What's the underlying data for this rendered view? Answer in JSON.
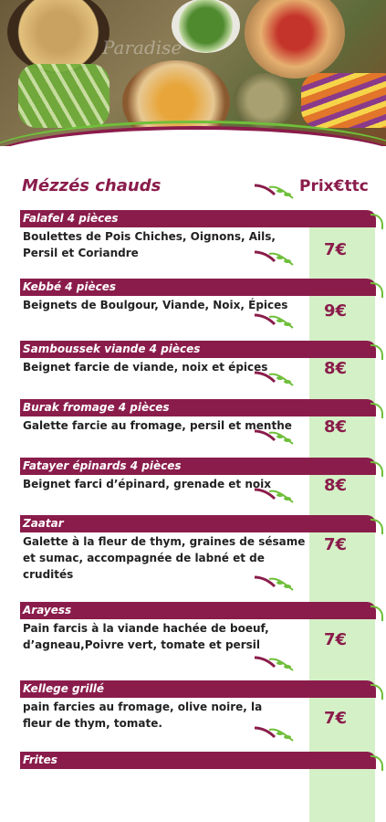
{
  "hero": {
    "brand_watermark": "Paradise"
  },
  "header": {
    "section_title": "Mézzés chauds",
    "price_title": "Prix€ttc"
  },
  "colors": {
    "accent": "#8a1c4b",
    "leaf": "#6fbf3a",
    "price_column": "#d4f0c6"
  },
  "items": [
    {
      "name": "Falafel 4 pièces",
      "description": "Boulettes de Pois Chiches, Oignons,  Ails,\n Persil et Coriandre",
      "price": "7€"
    },
    {
      "name": "Kebbé 4 pièces",
      "description": "Beignets de Boulgour, Viande, Noix, Épices",
      "price": "9€"
    },
    {
      "name": "Samboussek viande 4 pièces",
      "description": "Beignet farcie de viande, noix et épices",
      "price": "8€"
    },
    {
      "name": "Burak fromage 4 pièces",
      "description": "Galette farcie au fromage, persil et menthe",
      "price": "8€"
    },
    {
      "name": "Fatayer épinards 4 pièces",
      "description": "Beignet farci d’épinard, grenade et noix",
      "price": "8€"
    },
    {
      "name": "Zaatar",
      "description": "Galette à la fleur de thym, graines de sésame\n et sumac, accompagnée de labné et de\ncrudités",
      "price": "7€"
    },
    {
      "name": "Arayess",
      "description": "Pain farcis à la viande hachée de boeuf,\nd’agneau,Poivre vert, tomate et persil",
      "price": "7€"
    },
    {
      "name": "Kellege grillé",
      "description": "pain farcies au fromage, olive noire, la\nfleur de thym, tomate.",
      "price": "7€"
    },
    {
      "name": "Frites",
      "description": "",
      "price": ""
    }
  ]
}
